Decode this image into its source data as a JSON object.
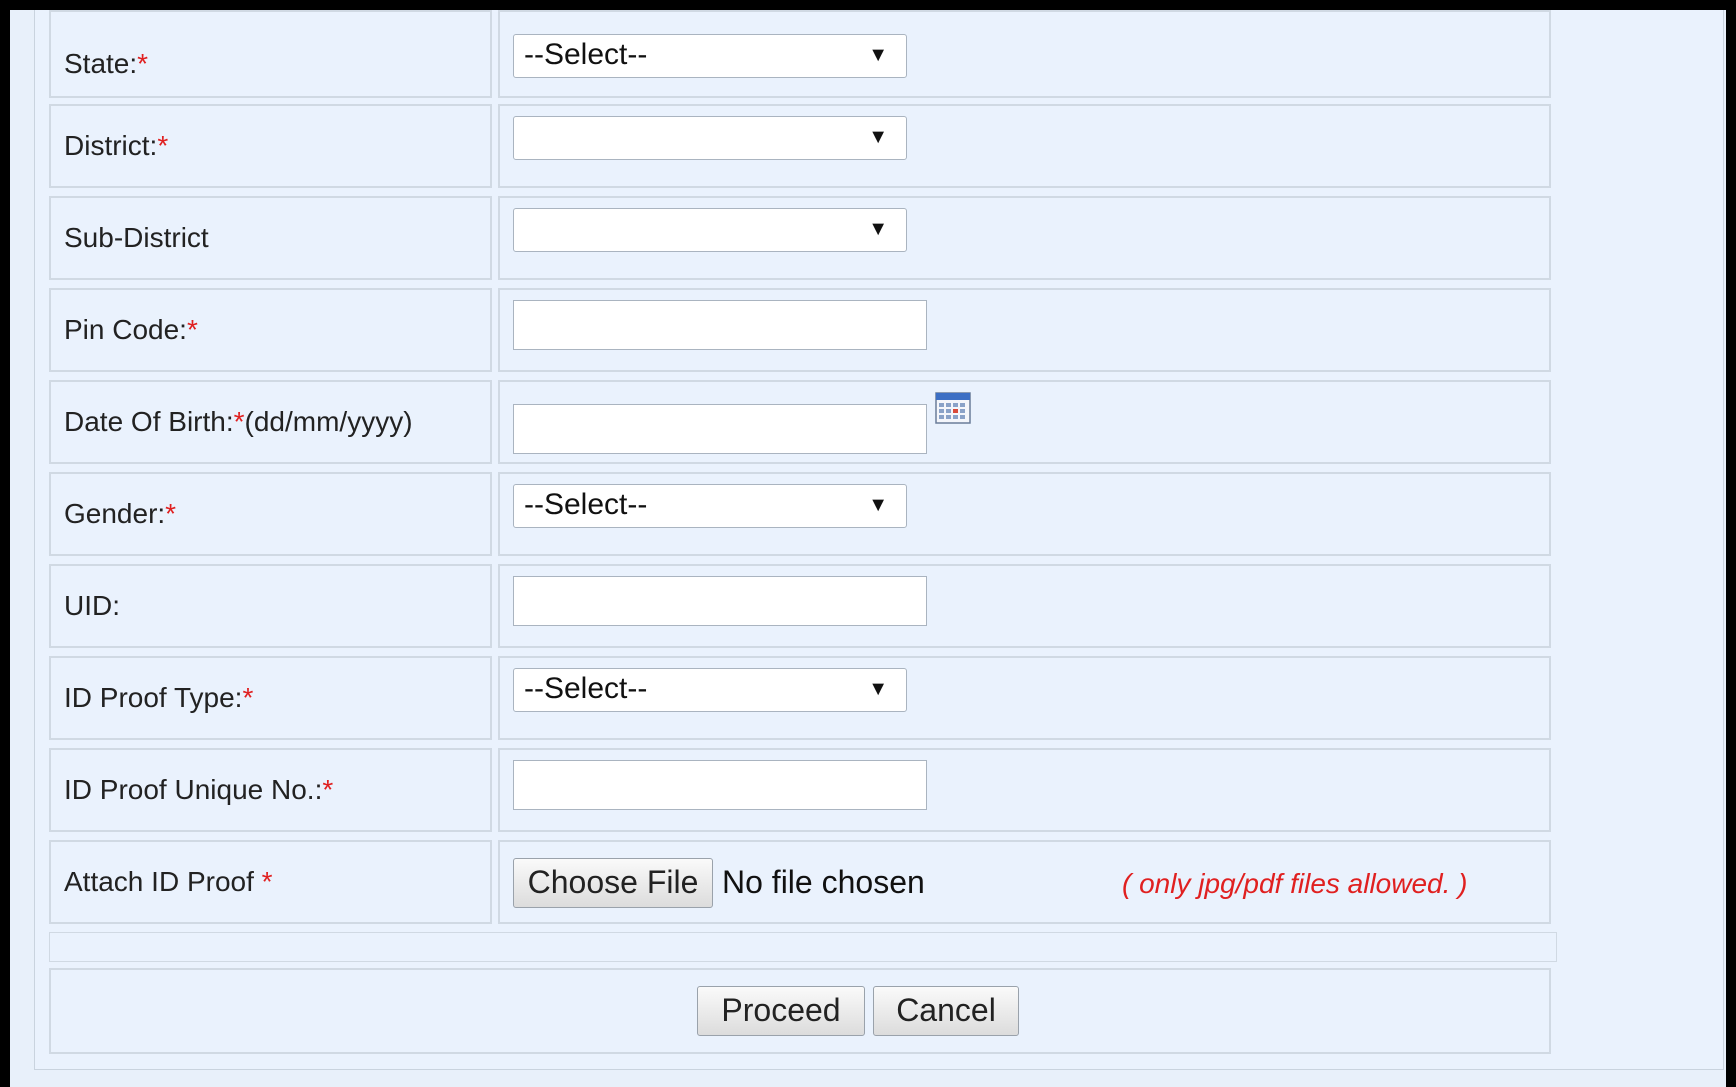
{
  "form": {
    "state": {
      "label": "State:",
      "required_mark": "*",
      "value": "--Select--"
    },
    "district": {
      "label": "District:",
      "required_mark": "*",
      "value": ""
    },
    "sub_district": {
      "label": "Sub-District",
      "value": ""
    },
    "pin_code": {
      "label": "Pin Code:",
      "required_mark": "*",
      "value": ""
    },
    "dob": {
      "label": "Date Of Birth:",
      "required_mark": "*",
      "format": "(dd/mm/yyyy)",
      "value": ""
    },
    "gender": {
      "label": "Gender:",
      "required_mark": "*",
      "value": "--Select--"
    },
    "uid": {
      "label": "UID:",
      "value": ""
    },
    "id_proof_type": {
      "label": "ID Proof Type:",
      "required_mark": "*",
      "value": "--Select--"
    },
    "id_proof_no": {
      "label": "ID Proof Unique No.:",
      "required_mark": "*",
      "value": ""
    },
    "attach": {
      "label": "Attach ID Proof ",
      "required_mark": "*",
      "button_label": "Choose File",
      "status": "No file chosen",
      "hint": "( only jpg/pdf files allowed. )"
    },
    "dropdown_arrow": "▼",
    "calendar_icon": "calendar-icon"
  },
  "actions": {
    "proceed_label": "Proceed",
    "cancel_label": "Cancel"
  },
  "colors": {
    "required": "#e02020",
    "panel_bg": "#eaf2fd",
    "border": "#d0d9e3"
  }
}
